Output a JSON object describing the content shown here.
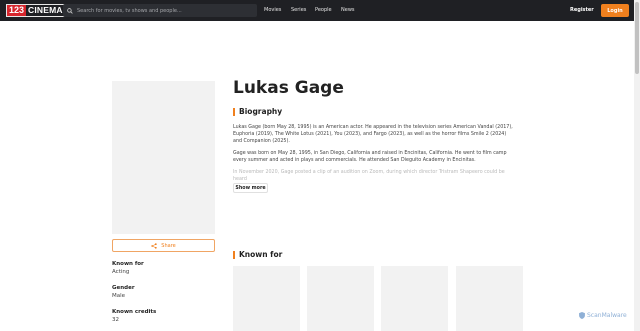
{
  "header": {
    "logo_number": "123",
    "logo_word": "CINEMAS",
    "search_placeholder": "Search for movies, tv shows and people...",
    "nav": [
      "Movies",
      "Series",
      "People",
      "News"
    ],
    "register_label": "Register",
    "login_label": "Login"
  },
  "person": {
    "name": "Lukas Gage",
    "share_label": "Share",
    "known_for_label": "Known for",
    "known_for_value": "Acting",
    "gender_label": "Gender",
    "gender_value": "Male",
    "credits_label": "Known credits",
    "credits_value": "32"
  },
  "biography": {
    "title": "Biography",
    "p1": "Lukas Gage (born May 28, 1995) is an American actor. He appeared in the television series American Vandal (2017), Euphoria (2019), The White Lotus (2021), You (2023), and Fargo (2023), as well as the horror films Smile 2 (2024) and Companion (2025).",
    "p2": "Gage was born on May 28, 1995, in San Diego, California and raised in Encinitas, California. He went to film camp every summer and acted in plays and commercials. He attended San Dieguito Academy in Encinitas.",
    "p3": "In November 2020, Gage posted a clip of an audition on Zoom, during which director Tristram Shapeero could be heard",
    "show_more_label": "Show more"
  },
  "known_for_section": {
    "title": "Known for"
  },
  "watermark": "ScanMalware",
  "colors": {
    "accent": "#f0801e",
    "header_bg": "#1f2024",
    "placeholder_bg": "#f2f2f2"
  }
}
